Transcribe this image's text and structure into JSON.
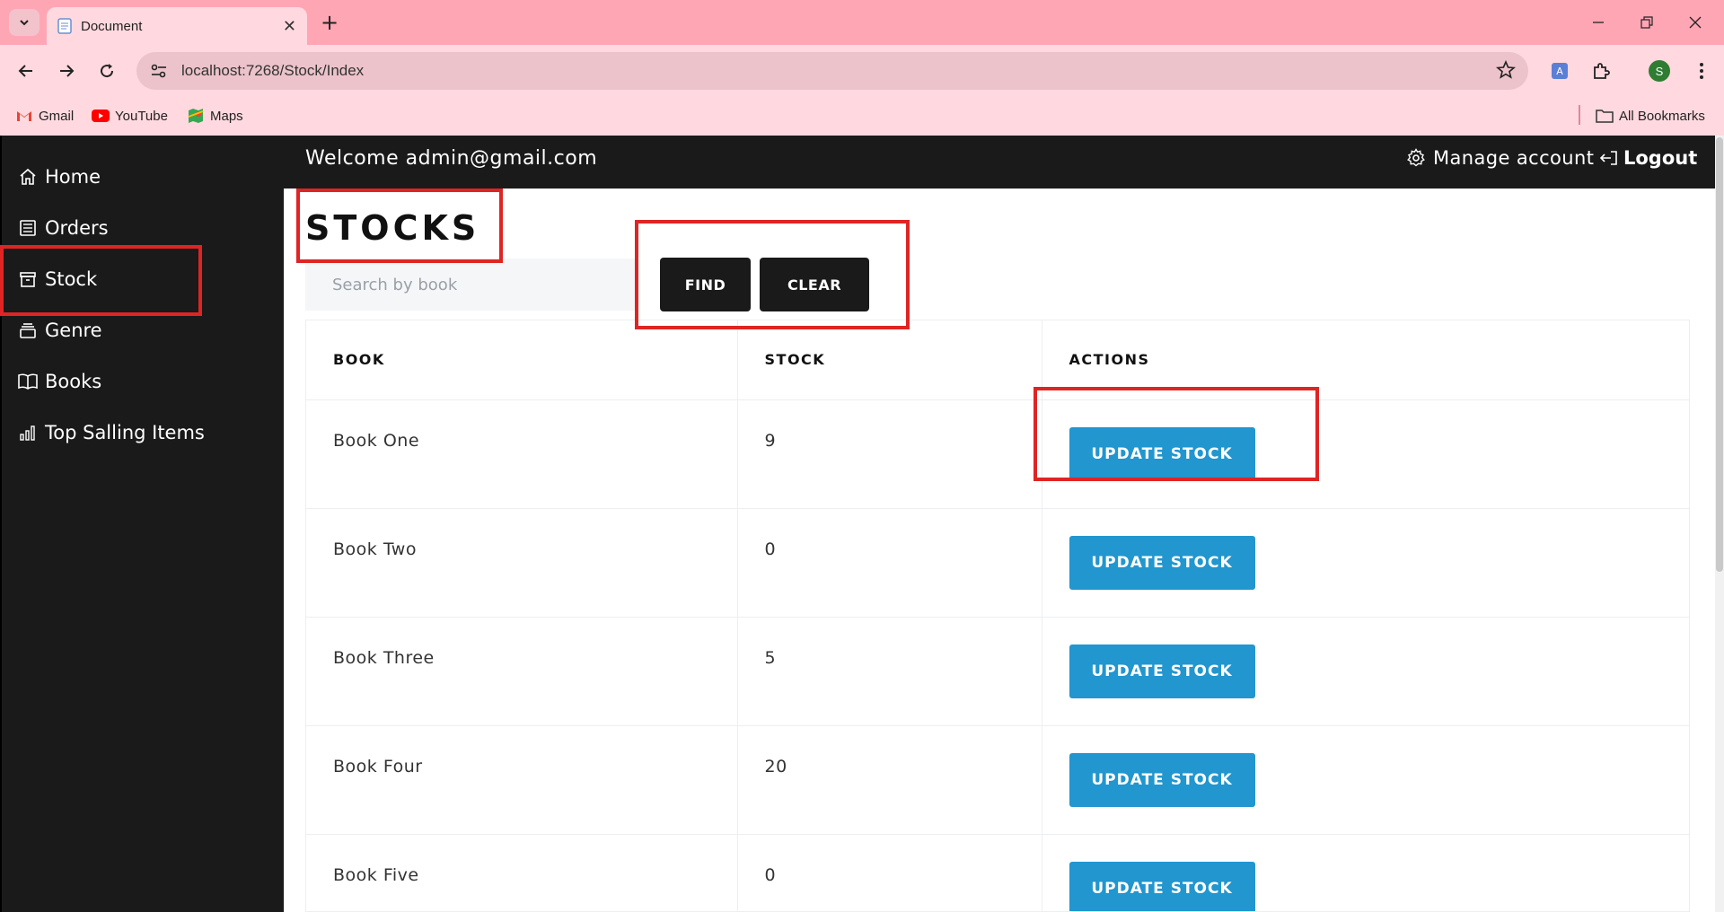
{
  "browser": {
    "tab_title": "Document",
    "url": "localhost:7268/Stock/Index",
    "profile_initial": "S",
    "bookmarks": [
      {
        "label": "Gmail"
      },
      {
        "label": "YouTube"
      },
      {
        "label": "Maps"
      }
    ],
    "all_bookmarks": "All Bookmarks"
  },
  "sidebar": {
    "items": [
      {
        "label": "Home",
        "icon": "home-icon"
      },
      {
        "label": "Orders",
        "icon": "orders-icon"
      },
      {
        "label": "Stock",
        "icon": "archive-icon"
      },
      {
        "label": "Genre",
        "icon": "stack-icon"
      },
      {
        "label": "Books",
        "icon": "book-icon"
      },
      {
        "label": "Top Salling Items",
        "icon": "bar-chart-icon"
      }
    ]
  },
  "header": {
    "welcome": "Welcome admin@gmail.com",
    "manage_account": "Manage account",
    "logout": "Logout"
  },
  "main": {
    "title": "STOCKS",
    "search_placeholder": "Search by book",
    "find_label": "FIND",
    "clear_label": "CLEAR",
    "columns": [
      "BOOK",
      "STOCK",
      "ACTIONS"
    ],
    "update_label": "UPDATE STOCK",
    "rows": [
      {
        "book": "Book One",
        "stock": "9"
      },
      {
        "book": "Book Two",
        "stock": "0"
      },
      {
        "book": "Book Three",
        "stock": "5"
      },
      {
        "book": "Book Four",
        "stock": "20"
      },
      {
        "book": "Book Five",
        "stock": "0"
      }
    ]
  },
  "colors": {
    "sidebar": "#1a1a1a",
    "accent_blue": "#2196cf",
    "highlight_red": "#e02424",
    "chrome_pink": "#ffa6b5"
  }
}
